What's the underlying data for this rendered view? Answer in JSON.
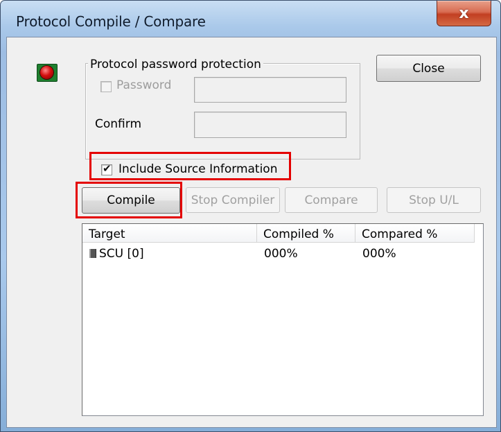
{
  "window": {
    "title": "Protocol Compile / Compare",
    "close_glyph": "x"
  },
  "protection": {
    "group_label": "Protocol password protection",
    "password_label": "Password",
    "password_checked": false,
    "password_value": "",
    "confirm_label": "Confirm",
    "confirm_value": ""
  },
  "include_source": {
    "label": "Include Source Information",
    "checked": true
  },
  "buttons": {
    "close": "Close",
    "compile": "Compile",
    "stop_compiler": "Stop Compiler",
    "compare": "Compare",
    "stop_ul": "Stop U/L"
  },
  "table": {
    "columns": [
      "Target",
      "Compiled %",
      "Compared %"
    ],
    "rows": [
      {
        "target": "SCU [0]",
        "compiled": "000%",
        "compared": "000%",
        "icon": "device-icon"
      }
    ]
  },
  "icons": {
    "status": "red-led-icon",
    "title_close": "close-icon"
  },
  "colors": {
    "highlight": "#e40000",
    "led_red": "#d40f0f",
    "led_base": "#1f7f2f"
  }
}
